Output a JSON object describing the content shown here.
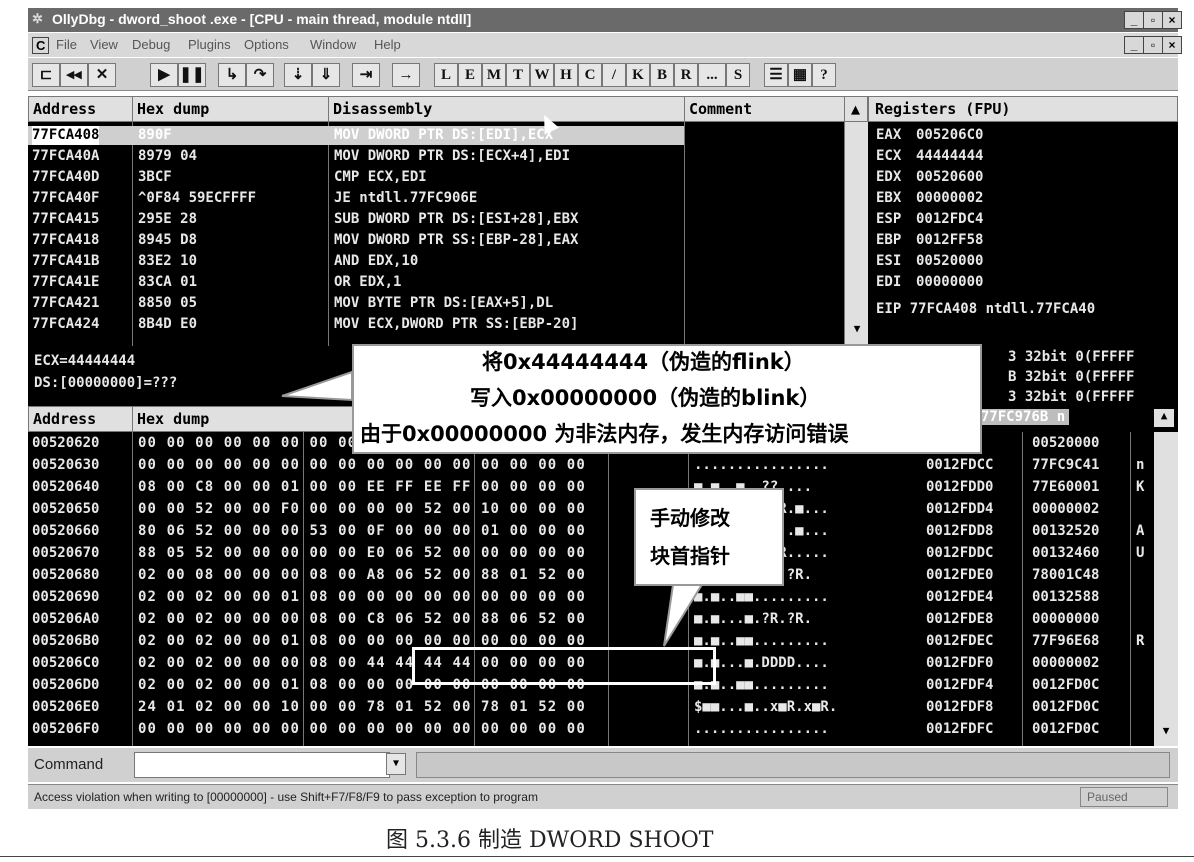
{
  "window": {
    "title": "OllyDbg - dword_shoot .exe - [CPU - main thread, module ntdll]",
    "buttons": [
      "_",
      "▫",
      "×"
    ]
  },
  "menu": [
    "C",
    "File",
    "View",
    "Debug",
    "Plugins",
    "Options",
    "Window",
    "Help"
  ],
  "toolbar": {
    "icons": [
      "open-icon",
      "rewind-icon",
      "close-icon",
      "run-icon",
      "pause-icon",
      "step-into-icon",
      "step-over-icon",
      "trace-into-icon",
      "trace-over-icon",
      "execute-till-return-icon",
      "go-to-icon"
    ],
    "letters": [
      "L",
      "E",
      "M",
      "T",
      "W",
      "H",
      "C",
      "/",
      "K",
      "B",
      "R",
      "...",
      "S"
    ],
    "extra": [
      "list-icon",
      "grid-icon",
      "?"
    ]
  },
  "disasm": {
    "headers": [
      "Address",
      "Hex dump",
      "Disassembly",
      "Comment"
    ],
    "rows": [
      {
        "addr": "77FCA408",
        "hex": "890F",
        "dis": "MOV DWORD PTR DS:[EDI],ECX"
      },
      {
        "addr": "77FCA40A",
        "hex": "8979 04",
        "dis": "MOV DWORD PTR DS:[ECX+4],EDI"
      },
      {
        "addr": "77FCA40D",
        "hex": "3BCF",
        "dis": "CMP ECX,EDI"
      },
      {
        "addr": "77FCA40F",
        "hex": "^0F84 59ECFFFF",
        "dis": "JE ntdll.77FC906E"
      },
      {
        "addr": "77FCA415",
        "hex": "295E 28",
        "dis": "SUB DWORD PTR DS:[ESI+28],EBX"
      },
      {
        "addr": "77FCA418",
        "hex": "8945 D8",
        "dis": "MOV DWORD PTR SS:[EBP-28],EAX"
      },
      {
        "addr": "77FCA41B",
        "hex": "83E2 10",
        "dis": "AND EDX,10"
      },
      {
        "addr": "77FCA41E",
        "hex": "83CA 01",
        "dis": "OR EDX,1"
      },
      {
        "addr": "77FCA421",
        "hex": "8850 05",
        "dis": "MOV BYTE PTR DS:[EAX+5],DL"
      },
      {
        "addr": "77FCA424",
        "hex": "8B4D E0",
        "dis": "MOV ECX,DWORD PTR SS:[EBP-20]"
      }
    ]
  },
  "registers": {
    "header": "Registers (FPU)",
    "rows": [
      {
        "name": "EAX",
        "value": "005206C0"
      },
      {
        "name": "ECX",
        "value": "44444444"
      },
      {
        "name": "EDX",
        "value": "00520600"
      },
      {
        "name": "EBX",
        "value": "00000002"
      },
      {
        "name": "ESP",
        "value": "0012FDC4"
      },
      {
        "name": "EBP",
        "value": "0012FF58"
      },
      {
        "name": "ESI",
        "value": "00520000"
      },
      {
        "name": "EDI",
        "value": "00000000"
      }
    ],
    "eip": "EIP 77FCA408 ntdll.77FCA40",
    "extra": [
      "3 32bit 0(FFFFF",
      "B 32bit 0(FFFFF",
      "3 32bit 0(FFFFF"
    ]
  },
  "info": {
    "line1": "ECX=44444444",
    "line2": "DS:[00000000]=???"
  },
  "dump": {
    "headers": [
      "Address",
      "Hex dump"
    ],
    "rows": [
      {
        "addr": "00520620",
        "hex": "00 00 00 00 00 00 00 00 00 00 00 00 00 00 00 00",
        "ascii": "................"
      },
      {
        "addr": "00520630",
        "hex": "00 00 00 00 00 00 00 00 00 00 00 00 00 00 00 00",
        "ascii": "................"
      },
      {
        "addr": "00520640",
        "hex": "08 00 C8 00 00 01 00 00 EE FF EE FF 00 00 00 00",
        "ascii": "■.■..■..??.... "
      },
      {
        "addr": "00520650",
        "hex": "00 00 52 00 00 F0 00 00 00 00 52 00 10 00 00 00",
        "ascii": "..R..■....R.■..."
      },
      {
        "addr": "00520660",
        "hex": "80 06 52 00 00 00 53 00 0F 00 00 00 01 00 00 00",
        "ascii": "■■R...S.■...■..."
      },
      {
        "addr": "00520670",
        "hex": "88 05 52 00 00 00 00 00 E0 06 52 00 00 00 00 00",
        "ascii": "■■R.....■■R....."
      },
      {
        "addr": "00520680",
        "hex": "02 00 08 00 00 00 08 00 A8 06 52 00 88 01 52 00",
        "ascii": "■.■...■.?R.?R."
      },
      {
        "addr": "00520690",
        "hex": "02 00 02 00 00 01 08 00 00 00 00 00 00 00 00 00",
        "ascii": "■.■..■■........."
      },
      {
        "addr": "005206A0",
        "hex": "02 00 02 00 00 00 08 00 C8 06 52 00 88 06 52 00",
        "ascii": "■.■...■.?R.?R."
      },
      {
        "addr": "005206B0",
        "hex": "02 00 02 00 00 01 08 00 00 00 00 00 00 00 00 00",
        "ascii": "■.■..■■........."
      },
      {
        "addr": "005206C0",
        "hex": "02 00 02 00 00 00 08 00 44 44 44 44 00 00 00 00",
        "ascii": "■.■...■.DDDD...."
      },
      {
        "addr": "005206D0",
        "hex": "02 00 02 00 00 01 08 00 00 00 00 00 00 00 00 00",
        "ascii": "■.■..■■........."
      },
      {
        "addr": "005206E0",
        "hex": "24 01 02 00 00 10 00 00 78 01 52 00 78 01 52 00",
        "ascii": "$■■...■..x■R.x■R."
      },
      {
        "addr": "005206F0",
        "hex": "00 00 00 00 00 00 00 00 00 00 00 00 00 00 00 00",
        "ascii": "................"
      }
    ]
  },
  "stack": {
    "top": "4 77FC976B n",
    "rows": [
      {
        "addr": "8",
        "val": "00520000",
        "c": ""
      },
      {
        "addr": "0012FDCC",
        "val": "77FC9C41",
        "c": "n"
      },
      {
        "addr": "0012FDD0",
        "val": "77E60001",
        "c": "K"
      },
      {
        "addr": "0012FDD4",
        "val": "00000002",
        "c": ""
      },
      {
        "addr": "0012FDD8",
        "val": "00132520",
        "c": "A"
      },
      {
        "addr": "0012FDDC",
        "val": "00132460",
        "c": "U"
      },
      {
        "addr": "0012FDE0",
        "val": "78001C48",
        "c": ""
      },
      {
        "addr": "0012FDE4",
        "val": "00132588",
        "c": ""
      },
      {
        "addr": "0012FDE8",
        "val": "00000000",
        "c": ""
      },
      {
        "addr": "0012FDEC",
        "val": "77F96E68",
        "c": "R"
      },
      {
        "addr": "0012FDF0",
        "val": "00000002",
        "c": ""
      },
      {
        "addr": "0012FDF4",
        "val": "0012FD0C",
        "c": ""
      },
      {
        "addr": "0012FDF8",
        "val": "0012FD0C",
        "c": ""
      },
      {
        "addr": "0012FDFC",
        "val": "0012FD0C",
        "c": ""
      }
    ]
  },
  "callout_main": {
    "line1": "将0x44444444（伪造的flink）",
    "line2": "写入0x00000000（伪造的blink）",
    "line3": "由于0x00000000 为非法内存，发生内存访问错误"
  },
  "callout_small": {
    "line1": "手动修改",
    "line2": "块首指针"
  },
  "command": {
    "label": "Command",
    "value": ""
  },
  "status": {
    "message": "Access violation when writing to [00000000] - use Shift+F7/F8/F9 to pass exception to program",
    "state": "Paused"
  },
  "caption": "图 5.3.6 制造 DWORD SHOOT"
}
